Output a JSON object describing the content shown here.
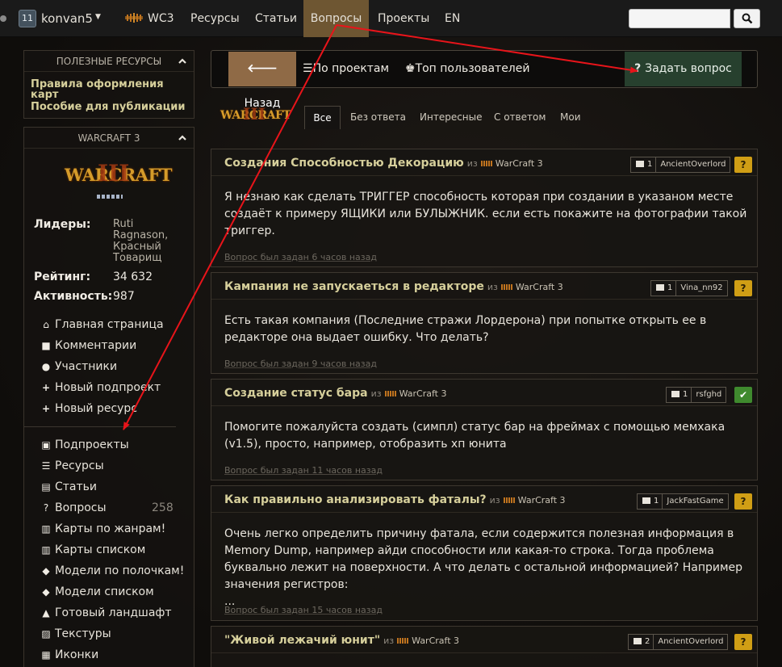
{
  "topnav": {
    "level": "11",
    "username": "konvan5",
    "game": "WC3",
    "items": [
      "Ресурсы",
      "Статьи",
      "Вопросы",
      "Проекты",
      "EN"
    ],
    "search_value": ""
  },
  "sidebar": {
    "useful": {
      "title": "ПОЛЕЗНЫЕ РЕСУРСЫ",
      "links": [
        "Правила оформления карт",
        "Пособие для публикации"
      ]
    },
    "project": {
      "title": "WARCRAFT 3",
      "logo_text": "WARCRAFT",
      "leaders_label": "Лидеры:",
      "leaders": "Ruti Ragnason, Красный Товарищ",
      "rating_label": "Рейтинг:",
      "rating": "34 632",
      "activity_label": "Активность:",
      "activity": "987"
    },
    "menu1": [
      {
        "icon": "home-icon",
        "label": "Главная страница"
      },
      {
        "icon": "comments-icon",
        "label": "Комментарии"
      },
      {
        "icon": "users-icon",
        "label": "Участники"
      },
      {
        "icon": "plus-icon",
        "label": "Новый подпроект"
      },
      {
        "icon": "plus-icon",
        "label": "Новый ресурс"
      }
    ],
    "menu2": [
      {
        "icon": "briefcase-icon",
        "label": "Подпроекты"
      },
      {
        "icon": "list-icon",
        "label": "Ресурсы"
      },
      {
        "icon": "book-icon",
        "label": "Статьи"
      },
      {
        "icon": "question-icon",
        "label": "Вопросы",
        "count": "258"
      },
      {
        "icon": "map-icon",
        "label": "Карты по жанрам!"
      },
      {
        "icon": "map-icon",
        "label": "Карты списком"
      },
      {
        "icon": "cube-icon",
        "label": "Модели по полочкам!"
      },
      {
        "icon": "cube-icon",
        "label": "Модели списком"
      },
      {
        "icon": "tree-icon",
        "label": "Готовый ландшафт"
      },
      {
        "icon": "image-icon",
        "label": "Текстуры"
      },
      {
        "icon": "grid-icon",
        "label": "Иконки"
      }
    ]
  },
  "actions": {
    "back": "Назад",
    "by_projects": "По проектам",
    "top_users": "Топ пользователей",
    "ask": "Задать вопрос"
  },
  "tabs": [
    "Все",
    "Без ответа",
    "Интересные",
    "С ответом",
    "Мои"
  ],
  "questions": [
    {
      "title": "Создания Способностью Декорацию",
      "from": "из",
      "category": "WarCraft 3",
      "comments": "1",
      "author": "AncientOverlord",
      "status": "?",
      "body": "Я незнаю как сделать ТРИГГЕР способность которая при создании в указаном месте создаёт к примеру ЯЩИКИ или БУЛЫЖНИК. если есть покажите на фотографии такой триггер.",
      "time": "Вопрос был задан 6 часов назад"
    },
    {
      "title": "Кампания не запускаеться в редакторе",
      "from": "из",
      "category": "WarCraft 3",
      "comments": "1",
      "author": "Vina_nn92",
      "status": "?",
      "body": "Есть такая компания (Последние стражи Лордерона) при попытке открыть ее в редакторе она выдает ошибку. Что делать?",
      "time": "Вопрос был задан 9 часов назад"
    },
    {
      "title": "Создание статус бара",
      "from": "из",
      "category": "WarCraft 3",
      "comments": "1",
      "author": "rsfghd",
      "status": "✔",
      "body": "Помогите пожалуйста создать (симпл) статус бар на фреймах с помощью мемхака (v1.5), просто, например, отобразить хп юнита",
      "time": "Вопрос был задан 11 часов назад"
    },
    {
      "title": "Как правильно анализировать фаталы?",
      "from": "из",
      "category": "WarCraft 3",
      "comments": "1",
      "author": "JackFastGame",
      "status": "?",
      "body": "Очень легко определить причину фатала, если содержится полезная информация в Memory Dump, например айди способности или какая-то строка. Тогда проблема буквально лежит на поверхности. А что делать с остальной информацией? Например значения регистров:",
      "ellipsis": "...",
      "time": "Вопрос был задан 15 часов назад"
    },
    {
      "title": "\"Живой лежачий юнит\"",
      "from": "из",
      "category": "WarCraft 3",
      "comments": "2",
      "author": "AncientOverlord",
      "status": "?",
      "body": "",
      "time": ""
    }
  ],
  "colors": {
    "accent_gold": "#d6cf9b",
    "nav_active": "#6e5632",
    "back_button": "#8f6a46",
    "ask_button": "#27402e",
    "status_question": "#d09e15",
    "status_solved": "#3f8a2e",
    "annotation": "#e8141a"
  }
}
